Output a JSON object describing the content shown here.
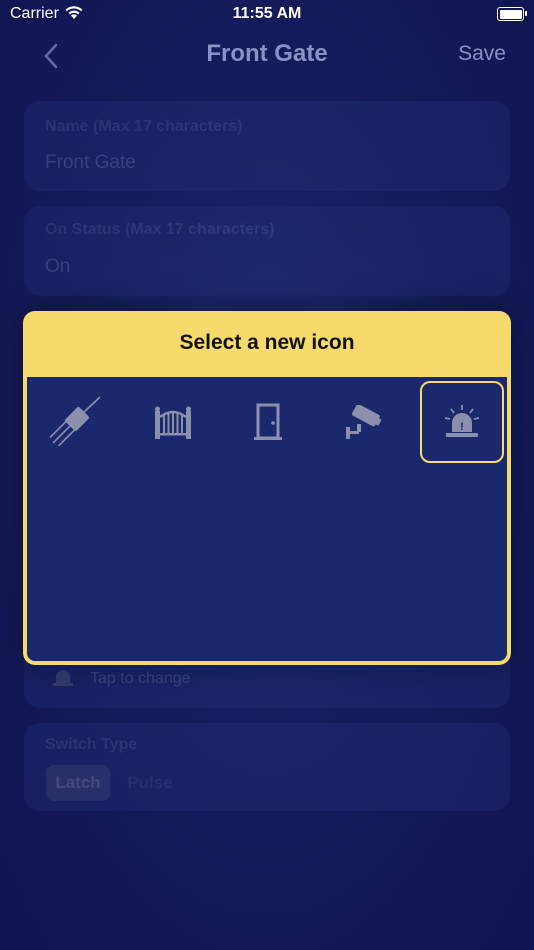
{
  "status_bar": {
    "carrier": "Carrier",
    "time": "11:55 AM"
  },
  "nav": {
    "title": "Front Gate",
    "save_label": "Save",
    "back_icon": "chevron-left-icon"
  },
  "form": {
    "name_label": "Name (Max 17 characters)",
    "name_value": "Front Gate",
    "on_status_label": "On Status (Max 17 characters)",
    "on_status_value": "On",
    "tap_to_change": "Tap to change",
    "switch_type_label": "Switch Type",
    "switch_options": [
      "Latch",
      "Pulse"
    ],
    "switch_selected": "Latch"
  },
  "icon_picker": {
    "title": "Select a new icon",
    "icons": [
      "power-cable-icon",
      "gate-icon",
      "door-icon",
      "security-camera-icon",
      "siren-alarm-icon"
    ],
    "selected_icon": "siren-alarm-icon"
  },
  "colors": {
    "accent_yellow": "#f7da6c",
    "modal_background": "#1a286c",
    "icon_gray": "#8c90ad",
    "background_navy": "#141d5c"
  }
}
